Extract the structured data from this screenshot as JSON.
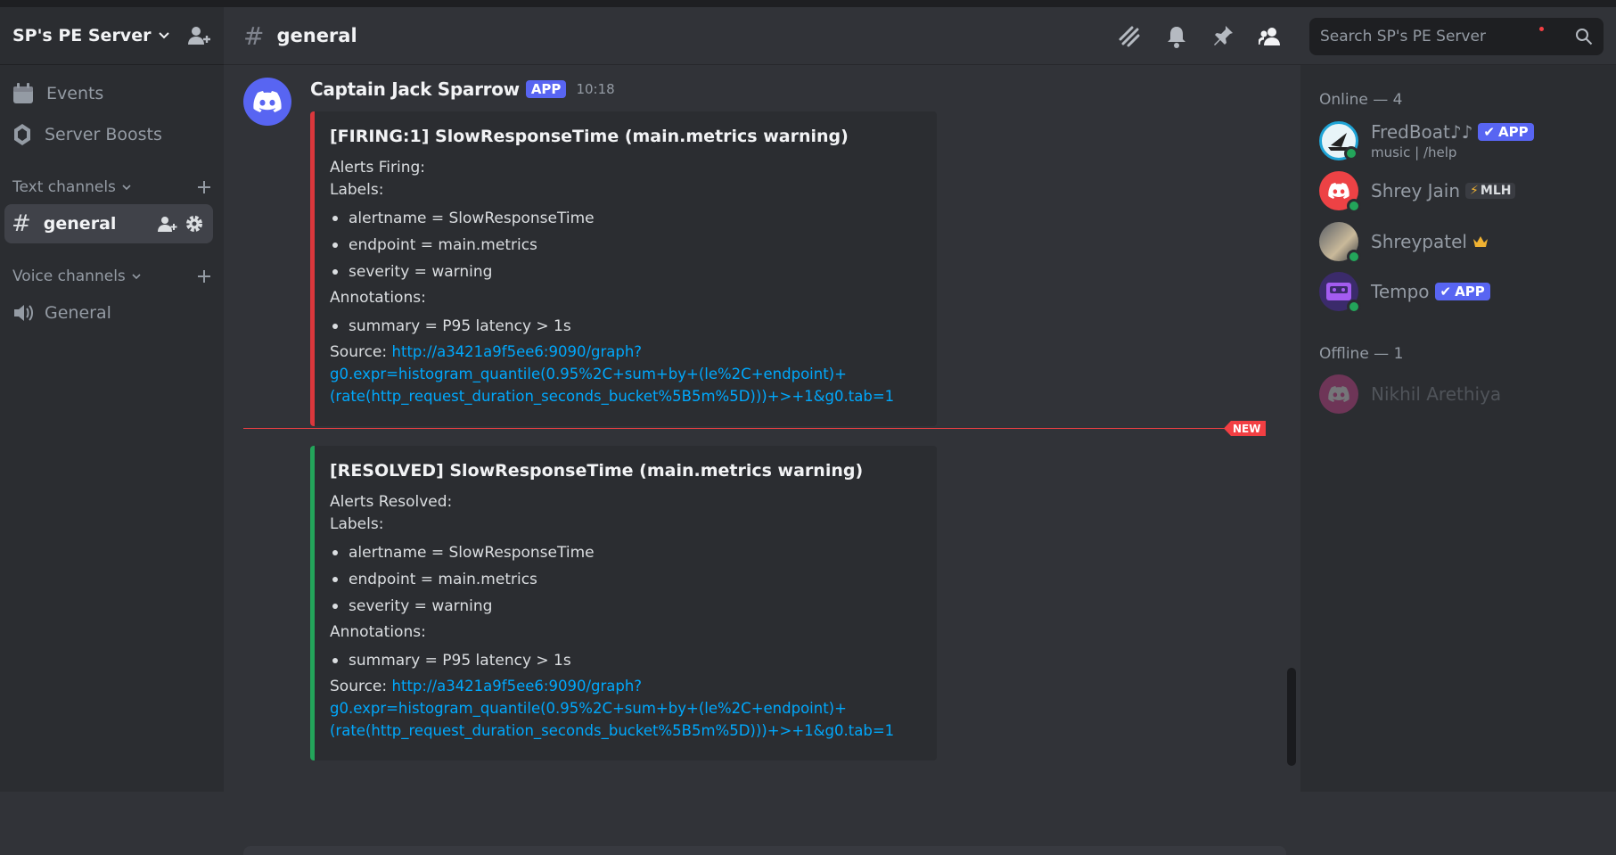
{
  "server": {
    "name": "SP's PE Server"
  },
  "sidebar": {
    "nav": [
      {
        "label": "Events"
      },
      {
        "label": "Server Boosts"
      }
    ],
    "text_category": "Text channels",
    "text_channels": [
      {
        "name": "general"
      }
    ],
    "voice_category": "Voice channels",
    "voice_channels": [
      {
        "name": "General"
      }
    ]
  },
  "header": {
    "channel": "general",
    "search_placeholder": "Search SP's PE Server"
  },
  "message": {
    "author": "Captain Jack Sparrow",
    "badge": "APP",
    "time": "10:18",
    "new_label": "NEW",
    "embeds": [
      {
        "color": "#da373c",
        "title": "[FIRING:1] SlowResponseTime (main.metrics warning)",
        "status_line": "Alerts Firing:",
        "labels_heading": "Labels:",
        "labels": [
          "alertname = SlowResponseTime",
          "endpoint = main.metrics",
          "severity = warning"
        ],
        "annotations_heading": "Annotations:",
        "annotations": [
          "summary = P95 latency > 1s"
        ],
        "source_label": "Source:",
        "source_url_1": "http://a3421a9f5ee6:9090/graph?",
        "source_url_2": "g0.expr=histogram_quantile(0.95%2C+sum+by+(le%2C+endpoint)+",
        "source_url_3": "(rate(http_request_duration_seconds_bucket%5B5m%5D)))+>+1&g0.tab=1"
      },
      {
        "color": "#23a55a",
        "title": "[RESOLVED] SlowResponseTime (main.metrics warning)",
        "status_line": "Alerts Resolved:",
        "labels_heading": "Labels:",
        "labels": [
          "alertname = SlowResponseTime",
          "endpoint = main.metrics",
          "severity = warning"
        ],
        "annotations_heading": "Annotations:",
        "annotations": [
          "summary = P95 latency > 1s"
        ],
        "source_label": "Source:",
        "source_url_1": "http://a3421a9f5ee6:9090/graph?",
        "source_url_2": "g0.expr=histogram_quantile(0.95%2C+sum+by+(le%2C+endpoint)+",
        "source_url_3": "(rate(http_request_duration_seconds_bucket%5B5m%5D)))+>+1&g0.tab=1"
      }
    ]
  },
  "members": {
    "online_title": "Online — 4",
    "offline_title": "Offline — 1",
    "online": [
      {
        "name": "FredBoat♪♪",
        "badge": "APP",
        "sub": "music | /help"
      },
      {
        "name": "Shrey Jain",
        "badge": "MLH"
      },
      {
        "name": "Shreypatel"
      },
      {
        "name": "Tempo",
        "badge": "APP"
      }
    ],
    "offline": [
      {
        "name": "Nikhil Arethiya"
      }
    ]
  }
}
